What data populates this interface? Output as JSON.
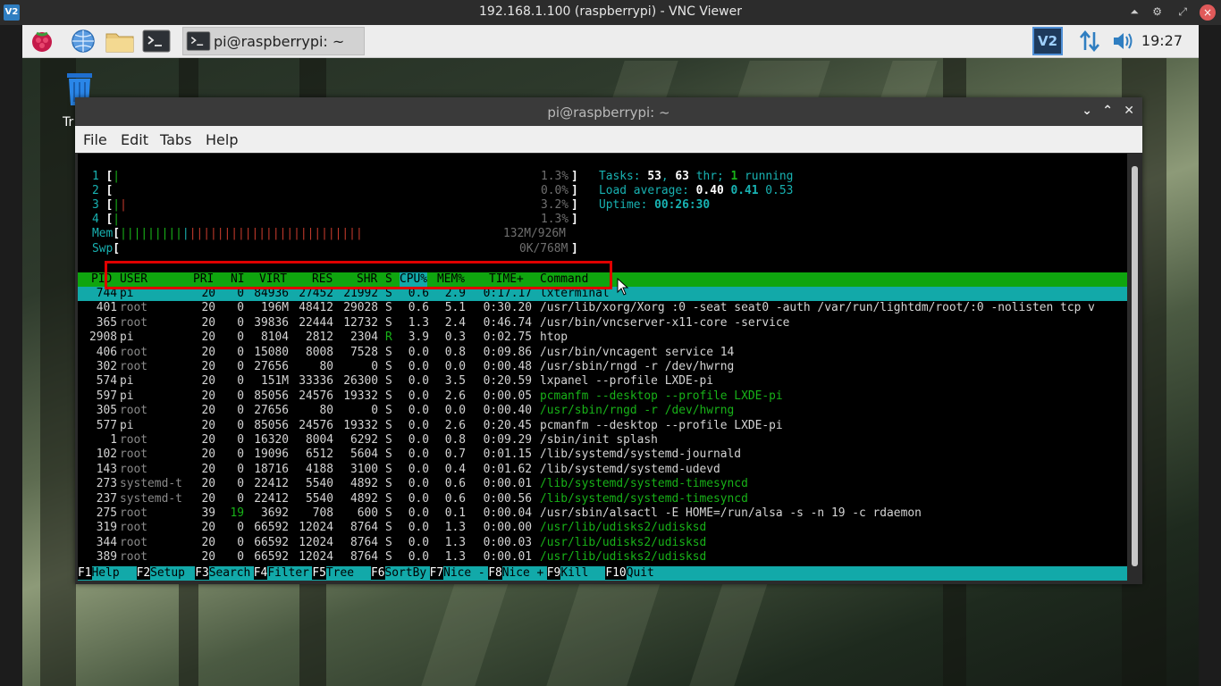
{
  "vnc": {
    "logo_text": "V2",
    "title": "192.168.1.100 (raspberrypi) - VNC Viewer",
    "controls": [
      "⏶",
      "⚙",
      "⤢",
      "×"
    ]
  },
  "taskbar": {
    "task_label": "pi@raspberrypi: ~",
    "vnc_tray_text": "V2",
    "clock": "19:27"
  },
  "desktop": {
    "trash_label_fragment": "Tr"
  },
  "terminal": {
    "title": "pi@raspberrypi: ~",
    "menu": [
      "File",
      "Edit",
      "Tabs",
      "Help"
    ],
    "cpu_bars": [
      {
        "n": "1",
        "pct": "1.3%"
      },
      {
        "n": "2",
        "pct": "0.0%"
      },
      {
        "n": "3",
        "pct": "3.2%"
      },
      {
        "n": "4",
        "pct": "1.3%"
      }
    ],
    "mem": {
      "label": "Mem",
      "value": "132M/926M"
    },
    "swp": {
      "label": "Swp",
      "value": "0K/768M"
    },
    "tasks": {
      "label": "Tasks:",
      "count": "53",
      "thr": "63",
      "thr_label": "thr;",
      "running": "1",
      "running_label": "running"
    },
    "load": {
      "label": "Load average:",
      "v1": "0.40",
      "v2": "0.41",
      "v3": "0.53"
    },
    "uptime": {
      "label": "Uptime:",
      "value": "00:26:30"
    },
    "columns": [
      "PID",
      "USER",
      "PRI",
      "NI",
      "VIRT",
      "RES",
      "SHR",
      "S",
      "CPU%",
      "MEM%",
      "TIME+",
      "Command"
    ],
    "processes": [
      {
        "pid": "744",
        "user": "pi",
        "pri": "20",
        "ni": "0",
        "virt": "84936",
        "res": "27452",
        "shr": "21992",
        "s": "S",
        "cpu": "0.6",
        "mem": "2.9",
        "time": "0:17.17",
        "cmd": "lxterminal"
      },
      {
        "pid": "401",
        "user": "root",
        "pri": "20",
        "ni": "0",
        "virt": "196M",
        "res": "48412",
        "shr": "29028",
        "s": "S",
        "cpu": "0.6",
        "mem": "5.1",
        "time": "0:30.20",
        "cmd": "/usr/lib/xorg/Xorg :0 -seat seat0 -auth /var/run/lightdm/root/:0 -nolisten tcp v"
      },
      {
        "pid": "365",
        "user": "root",
        "pri": "20",
        "ni": "0",
        "virt": "39836",
        "res": "22444",
        "shr": "12732",
        "s": "S",
        "cpu": "1.3",
        "mem": "2.4",
        "time": "0:46.74",
        "cmd": "/usr/bin/vncserver-x11-core -service"
      },
      {
        "pid": "2908",
        "user": "pi",
        "pri": "20",
        "ni": "0",
        "virt": "8104",
        "res": "2812",
        "shr": "2304",
        "s": "R",
        "cpu": "3.9",
        "mem": "0.3",
        "time": "0:02.75",
        "cmd": "htop"
      },
      {
        "pid": "406",
        "user": "root",
        "pri": "20",
        "ni": "0",
        "virt": "15080",
        "res": "8008",
        "shr": "7528",
        "s": "S",
        "cpu": "0.0",
        "mem": "0.8",
        "time": "0:09.86",
        "cmd": "/usr/bin/vncagent service 14"
      },
      {
        "pid": "302",
        "user": "root",
        "pri": "20",
        "ni": "0",
        "virt": "27656",
        "res": "80",
        "shr": "0",
        "s": "S",
        "cpu": "0.0",
        "mem": "0.0",
        "time": "0:00.48",
        "cmd": "/usr/sbin/rngd -r /dev/hwrng"
      },
      {
        "pid": "574",
        "user": "pi",
        "pri": "20",
        "ni": "0",
        "virt": "151M",
        "res": "33336",
        "shr": "26300",
        "s": "S",
        "cpu": "0.0",
        "mem": "3.5",
        "time": "0:20.59",
        "cmd": "lxpanel --profile LXDE-pi"
      },
      {
        "pid": "597",
        "user": "pi",
        "pri": "20",
        "ni": "0",
        "virt": "85056",
        "res": "24576",
        "shr": "19332",
        "s": "S",
        "cpu": "0.0",
        "mem": "2.6",
        "time": "0:00.05",
        "cmd": "pcmanfm --desktop --profile LXDE-pi"
      },
      {
        "pid": "305",
        "user": "root",
        "pri": "20",
        "ni": "0",
        "virt": "27656",
        "res": "80",
        "shr": "0",
        "s": "S",
        "cpu": "0.0",
        "mem": "0.0",
        "time": "0:00.40",
        "cmd": "/usr/sbin/rngd -r /dev/hwrng"
      },
      {
        "pid": "577",
        "user": "pi",
        "pri": "20",
        "ni": "0",
        "virt": "85056",
        "res": "24576",
        "shr": "19332",
        "s": "S",
        "cpu": "0.0",
        "mem": "2.6",
        "time": "0:20.45",
        "cmd": "pcmanfm --desktop --profile LXDE-pi"
      },
      {
        "pid": "1",
        "user": "root",
        "pri": "20",
        "ni": "0",
        "virt": "16320",
        "res": "8004",
        "shr": "6292",
        "s": "S",
        "cpu": "0.0",
        "mem": "0.8",
        "time": "0:09.29",
        "cmd": "/sbin/init splash"
      },
      {
        "pid": "102",
        "user": "root",
        "pri": "20",
        "ni": "0",
        "virt": "19096",
        "res": "6512",
        "shr": "5604",
        "s": "S",
        "cpu": "0.0",
        "mem": "0.7",
        "time": "0:01.15",
        "cmd": "/lib/systemd/systemd-journald"
      },
      {
        "pid": "143",
        "user": "root",
        "pri": "20",
        "ni": "0",
        "virt": "18716",
        "res": "4188",
        "shr": "3100",
        "s": "S",
        "cpu": "0.0",
        "mem": "0.4",
        "time": "0:01.62",
        "cmd": "/lib/systemd/systemd-udevd"
      },
      {
        "pid": "273",
        "user": "systemd-t",
        "pri": "20",
        "ni": "0",
        "virt": "22412",
        "res": "5540",
        "shr": "4892",
        "s": "S",
        "cpu": "0.0",
        "mem": "0.6",
        "time": "0:00.01",
        "cmd": "/lib/systemd/systemd-timesyncd"
      },
      {
        "pid": "237",
        "user": "systemd-t",
        "pri": "20",
        "ni": "0",
        "virt": "22412",
        "res": "5540",
        "shr": "4892",
        "s": "S",
        "cpu": "0.0",
        "mem": "0.6",
        "time": "0:00.56",
        "cmd": "/lib/systemd/systemd-timesyncd"
      },
      {
        "pid": "275",
        "user": "root",
        "pri": "39",
        "ni": "19",
        "virt": "3692",
        "res": "708",
        "shr": "600",
        "s": "S",
        "cpu": "0.0",
        "mem": "0.1",
        "time": "0:00.04",
        "cmd": "/usr/sbin/alsactl -E HOME=/run/alsa -s -n 19 -c rdaemon"
      },
      {
        "pid": "319",
        "user": "root",
        "pri": "20",
        "ni": "0",
        "virt": "66592",
        "res": "12024",
        "shr": "8764",
        "s": "S",
        "cpu": "0.0",
        "mem": "1.3",
        "time": "0:00.00",
        "cmd": "/usr/lib/udisks2/udisksd"
      },
      {
        "pid": "344",
        "user": "root",
        "pri": "20",
        "ni": "0",
        "virt": "66592",
        "res": "12024",
        "shr": "8764",
        "s": "S",
        "cpu": "0.0",
        "mem": "1.3",
        "time": "0:00.03",
        "cmd": "/usr/lib/udisks2/udisksd"
      },
      {
        "pid": "389",
        "user": "root",
        "pri": "20",
        "ni": "0",
        "virt": "66592",
        "res": "12024",
        "shr": "8764",
        "s": "S",
        "cpu": "0.0",
        "mem": "1.3",
        "time": "0:00.01",
        "cmd": "/usr/lib/udisks2/udisksd"
      }
    ],
    "green_cmd_rows": [
      7,
      8,
      13,
      14,
      16,
      17,
      18
    ],
    "fkeys": [
      {
        "k": "F1",
        "v": "Help  "
      },
      {
        "k": "F2",
        "v": "Setup "
      },
      {
        "k": "F3",
        "v": "Search"
      },
      {
        "k": "F4",
        "v": "Filter"
      },
      {
        "k": "F5",
        "v": "Tree  "
      },
      {
        "k": "F6",
        "v": "SortBy"
      },
      {
        "k": "F7",
        "v": "Nice -"
      },
      {
        "k": "F8",
        "v": "Nice +"
      },
      {
        "k": "F9",
        "v": "Kill  "
      },
      {
        "k": "F10",
        "v": "Quit"
      }
    ]
  },
  "colors": {
    "htop_header_green": "#0fa50f",
    "htop_selected_cyan": "#12a9a9",
    "highlight_red": "#e00000"
  }
}
